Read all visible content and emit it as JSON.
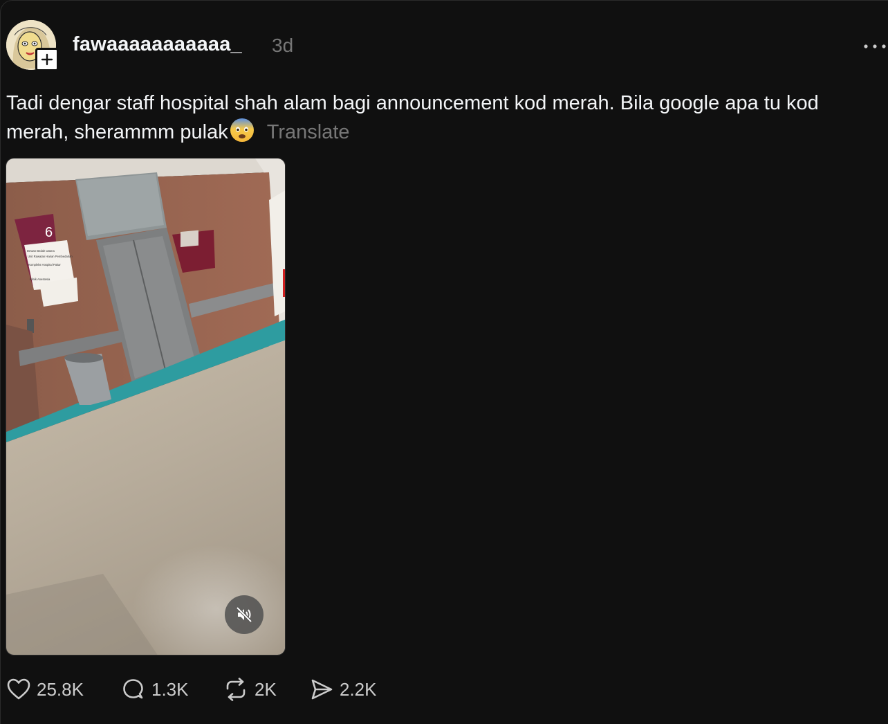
{
  "post": {
    "username": "fawaaaaaaaaaaa_",
    "time_ago": "3d",
    "caption": "Tadi dengar staff hospital shah alam bagi announcement kod merah. Bila google apa tu kod merah, sherammm pulak",
    "translate_label": "Translate",
    "media_sign": {
      "floor_number": "6",
      "lines": [
        "Dewan Bedah Utama",
        "Unit Rawatan Harian Pembedahan",
        "Kompleks Hospital Pakar",
        "Klinik Anestesia"
      ]
    }
  },
  "stats": {
    "likes": "25.8K",
    "comments": "1.3K",
    "reposts": "2K",
    "shares": "2.2K"
  },
  "icons": {
    "follow": "plus-icon",
    "more": "more-horizontal-icon",
    "mute": "speaker-muted-icon",
    "like": "heart-icon",
    "comment": "comment-bubble-icon",
    "repost": "repost-icon",
    "share": "send-icon",
    "emoji": "fearful-face-emoji"
  },
  "colors": {
    "background": "#101010",
    "text": "#f3f5f7",
    "muted": "#777777"
  }
}
